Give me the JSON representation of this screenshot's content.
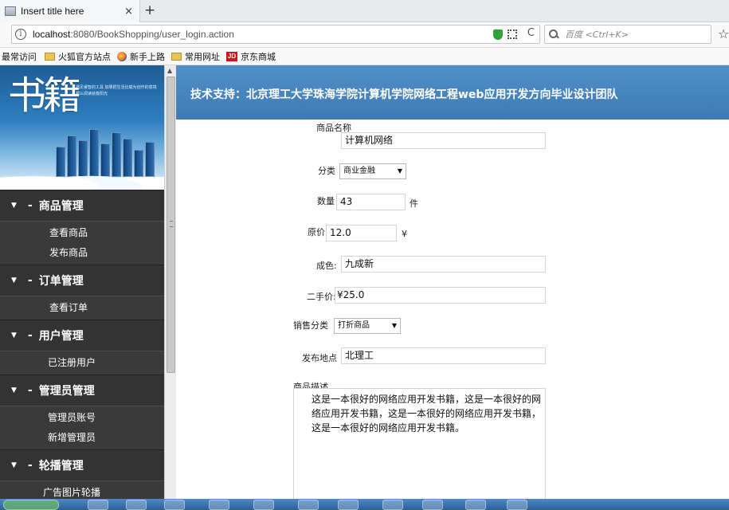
{
  "browser": {
    "tab_title": "Insert title here",
    "tab_close": "×",
    "new_tab": "+",
    "url_host": "localhost",
    "url_rest": ":8080/BookShopping/user_login.action",
    "refresh": "C",
    "search_placeholder": "百度 <Ctrl+K>",
    "star": "☆"
  },
  "bookmarks": [
    "最常访问",
    "火狐官方站点",
    "新手上路",
    "常用网址",
    "京东商城"
  ],
  "banner": {
    "title": "书籍",
    "subtitle": "遇见睿智的工具 如果把生活比喻为创作的意境 那么阅读就像阳光"
  },
  "sidebar": {
    "groups": [
      {
        "title": "商品管理",
        "items": [
          "查看商品",
          "发布商品"
        ]
      },
      {
        "title": "订单管理",
        "items": [
          "查看订单"
        ]
      },
      {
        "title": "用户管理",
        "items": [
          "已注册用户"
        ]
      },
      {
        "title": "管理员管理",
        "items": [
          "管理员账号",
          "新增管理员"
        ]
      },
      {
        "title": "轮播管理",
        "items": [
          "广告图片轮播"
        ]
      }
    ],
    "arrow": "▼",
    "dash": "-"
  },
  "header": {
    "text": "技术支持：北京理工大学珠海学院计算机学院网络工程web应用开发方向毕业设计团队"
  },
  "form": {
    "name_label": "商品名称",
    "name_value": "计算机网络",
    "category_label": "分类",
    "category_value": "商业金融",
    "quantity_label": "数量",
    "quantity_value": "43",
    "quantity_unit": "件",
    "price_label": "原价",
    "price_value": "12.0",
    "price_unit": "¥",
    "condition_label": "成色:",
    "condition_value": "九成新",
    "second_price_label": "二手价:",
    "second_price_value": "¥25.0",
    "sale_type_label": "销售分类",
    "sale_type_value": "打折商品",
    "location_label": "发布地点",
    "location_value": "北理工",
    "desc_label": "商品描述",
    "desc_value": "这是一本很好的网络应用开发书籍，这是一本很好的网络应用开发书籍，这是一本很好的网络应用开发书籍，这是一本很好的网络应用开发书籍。"
  }
}
